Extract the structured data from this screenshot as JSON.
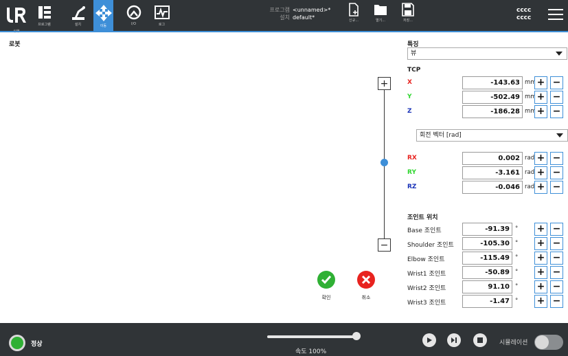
{
  "nav": {
    "items": [
      {
        "label": "실행",
        "icon": "run-icon"
      },
      {
        "label": "프로그램",
        "icon": "program-icon"
      },
      {
        "label": "설치",
        "icon": "installation-icon"
      },
      {
        "label": "이동",
        "icon": "move-icon",
        "active": true
      },
      {
        "label": "I/O",
        "icon": "io-icon"
      },
      {
        "label": "로그",
        "icon": "log-icon"
      }
    ]
  },
  "program": {
    "program_key": "프로그램",
    "program_value": "<unnamed>*",
    "install_key": "설치",
    "install_value": "default*"
  },
  "toolbar": {
    "new_label": "신규...",
    "open_label": "열기...",
    "save_label": "저장..."
  },
  "robot_name": {
    "line1": "cccc",
    "line2": "cccc"
  },
  "left": {
    "title": "로봇"
  },
  "actions": {
    "ok_label": "확인",
    "cancel_label": "취소"
  },
  "feature": {
    "title": "특징",
    "selected": "뷰"
  },
  "tcp": {
    "title": "TCP",
    "position": [
      {
        "axis": "X",
        "value": "-143.63",
        "unit": "mm",
        "color": "#e8231f"
      },
      {
        "axis": "Y",
        "value": "-502.49",
        "unit": "mm",
        "color": "#2fd62f"
      },
      {
        "axis": "Z",
        "value": "-186.28",
        "unit": "mm",
        "color": "#1a33b8"
      }
    ],
    "rotation_mode": "회전 벡터 [rad]",
    "rotation": [
      {
        "axis": "RX",
        "value": "0.002",
        "unit": "rad",
        "color": "#e8231f"
      },
      {
        "axis": "RY",
        "value": "-3.161",
        "unit": "rad",
        "color": "#2fd62f"
      },
      {
        "axis": "RZ",
        "value": "-0.046",
        "unit": "rad",
        "color": "#1a33b8"
      }
    ]
  },
  "joints": {
    "title": "조인트 위치",
    "items": [
      {
        "name": "Base 조인트",
        "value": "-91.39",
        "unit": "°"
      },
      {
        "name": "Shoulder 조인트",
        "value": "-105.30",
        "unit": "°"
      },
      {
        "name": "Elbow 조인트",
        "value": "-115.49",
        "unit": "°"
      },
      {
        "name": "Wrist1 조인트",
        "value": "-50.89",
        "unit": "°"
      },
      {
        "name": "Wrist2 조인트",
        "value": "91.10",
        "unit": "°"
      },
      {
        "name": "Wrist3 조인트",
        "value": "-1.47",
        "unit": "°"
      }
    ]
  },
  "buttons": {
    "plus": "+",
    "minus": "−"
  },
  "footer": {
    "status": "정상",
    "speed_label": "속도 100%",
    "speed_fraction": 1.0,
    "simulation_label": "시뮬레이션",
    "simulation_on": false
  },
  "colors": {
    "accent": "#3e8fd8",
    "ok": "#2fb034",
    "cancel": "#e8231f",
    "bar": "#303437"
  }
}
